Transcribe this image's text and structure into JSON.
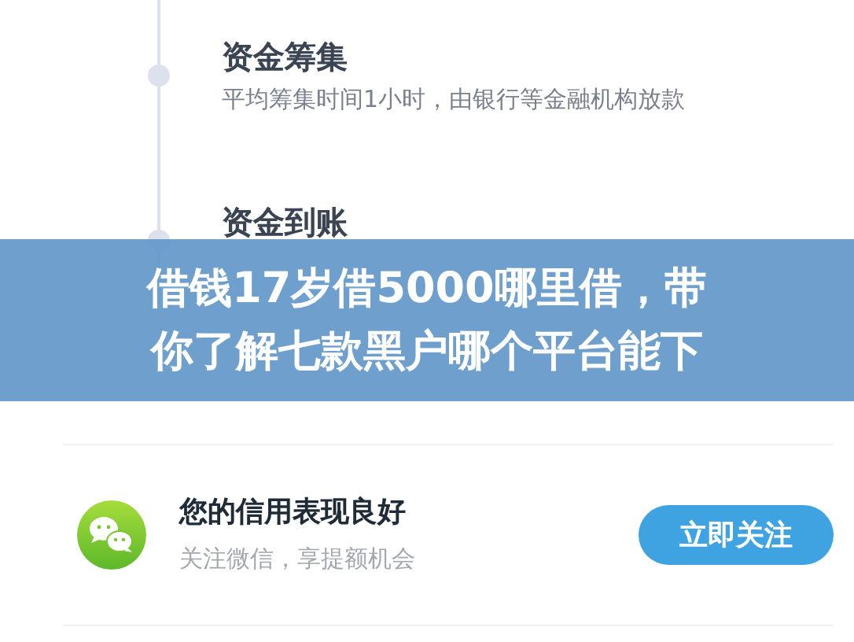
{
  "timeline": [
    {
      "title": "资金筹集",
      "description": "平均筹集时间1小时，由银行等金融机构放款"
    },
    {
      "title": "资金到账"
    }
  ],
  "banner": {
    "lines": [
      "借钱17岁借5000哪里借，带",
      "你了解七款黑户哪个平台能下"
    ]
  },
  "follow_card": {
    "title": "您的信用表现良好",
    "subtitle": "关注微信，享提额机会",
    "button": "立即关注"
  }
}
